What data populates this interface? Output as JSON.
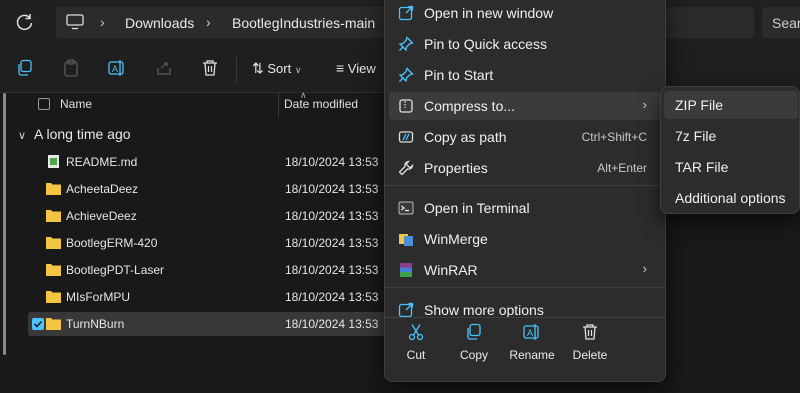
{
  "address": {
    "breadcrumbs": [
      "Downloads",
      "BootlegIndustries-main"
    ],
    "search_placeholder": "Sear"
  },
  "toolbar": {
    "sort_label": "Sort",
    "view_label": "View"
  },
  "list": {
    "columns": {
      "name": "Name",
      "date": "Date modified"
    },
    "group": "A long time ago",
    "rows": [
      {
        "name": "README.md",
        "date": "18/10/2024 13:53",
        "type": "file-icon"
      },
      {
        "name": "AcheetaDeez",
        "date": "18/10/2024 13:53",
        "type": "folder-icon"
      },
      {
        "name": "AchieveDeez",
        "date": "18/10/2024 13:53",
        "type": "folder-icon"
      },
      {
        "name": "BootlegERM-420",
        "date": "18/10/2024 13:53",
        "type": "folder-icon"
      },
      {
        "name": "BootlegPDT-Laser",
        "date": "18/10/2024 13:53",
        "type": "folder-icon"
      },
      {
        "name": "MIsForMPU",
        "date": "18/10/2024 13:53",
        "type": "folder-icon"
      },
      {
        "name": "TurnNBurn",
        "date": "18/10/2024 13:53",
        "type": "folder-icon",
        "selected": true
      }
    ]
  },
  "context_menu": {
    "items": [
      {
        "label": "Open in new window",
        "icon": "open-window-icon"
      },
      {
        "label": "Pin to Quick access",
        "icon": "pin-icon"
      },
      {
        "label": "Pin to Start",
        "icon": "pin-icon"
      },
      {
        "label": "Compress to...",
        "icon": "zip-folder-icon",
        "submenu": true
      },
      {
        "label": "Copy as path",
        "icon": "copy-path-icon",
        "shortcut": "Ctrl+Shift+C"
      },
      {
        "label": "Properties",
        "icon": "wrench-icon",
        "shortcut": "Alt+Enter"
      },
      {
        "label": "Open in Terminal",
        "icon": "terminal-icon"
      },
      {
        "label": "WinMerge",
        "icon": "winmerge-icon"
      },
      {
        "label": "WinRAR",
        "icon": "winrar-icon",
        "submenu": true
      },
      {
        "label": "Show more options",
        "icon": "more-options-icon"
      }
    ],
    "quick_actions": [
      {
        "label": "Cut",
        "icon": "scissors-icon"
      },
      {
        "label": "Copy",
        "icon": "copy-icon"
      },
      {
        "label": "Rename",
        "icon": "rename-icon"
      },
      {
        "label": "Delete",
        "icon": "trash-icon"
      }
    ]
  },
  "compress_submenu": {
    "items": [
      "ZIP File",
      "7z File",
      "TAR File",
      "Additional options"
    ]
  },
  "colors": {
    "accent": "#4cc2ff",
    "folder": "#f3c542",
    "menu_bg": "#2c2c2c",
    "highlight": "#3b3b3b"
  }
}
